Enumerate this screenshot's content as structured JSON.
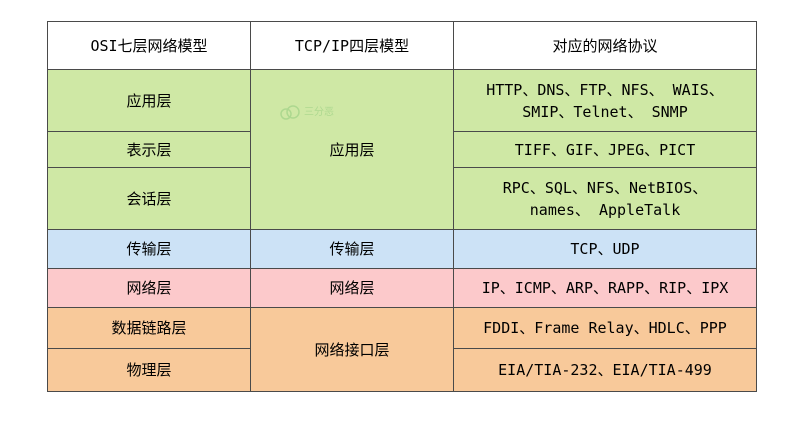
{
  "headers": [
    "OSI七层网络模型",
    "TCP/IP四层模型",
    "对应的网络协议"
  ],
  "osi_layers": {
    "application": "应用层",
    "presentation": "表示层",
    "session": "会话层",
    "transport": "传输层",
    "network": "网络层",
    "data_link": "数据链路层",
    "physical": "物理层"
  },
  "tcpip_layers": {
    "application": "应用层",
    "transport": "传输层",
    "network": "网络层",
    "link": "网络接口层"
  },
  "protocols": {
    "application_line1": "HTTP、DNS、FTP、NFS、 WAIS、",
    "application_line2": "SMIP、Telnet、 SNMP",
    "presentation": "TIFF、GIF、JPEG、PICT",
    "session_line1": "RPC、SQL、NFS、NetBIOS、",
    "session_line2": "names、 AppleTalk",
    "transport": "TCP、UDP",
    "network": "IP、ICMP、ARP、RAPP、RIP、IPX",
    "data_link": "FDDI、Frame Relay、HDLC、PPP",
    "physical": "EIA/TIA-232、EIA/TIA-499"
  },
  "colors": {
    "upper_layers": "#cfe8a5",
    "transport": "#cce2f6",
    "network": "#fcc9cb",
    "link": "#f8c99a"
  },
  "watermark": {
    "icon": "cloud-logo-icon",
    "text": "三分恶"
  }
}
